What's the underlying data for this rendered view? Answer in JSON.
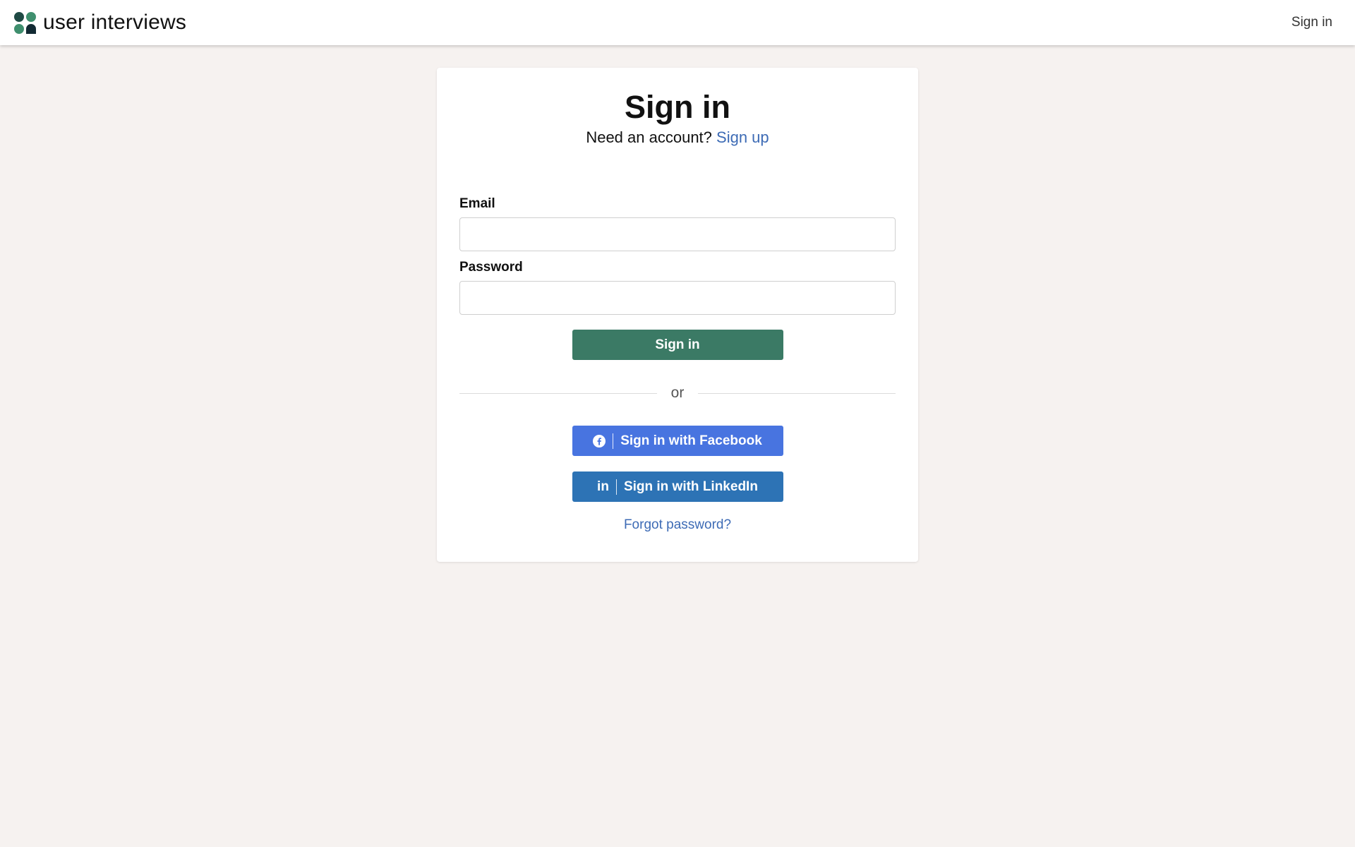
{
  "header": {
    "brand_name": "user interviews",
    "signin_link": "Sign in"
  },
  "form": {
    "title": "Sign in",
    "subtitle_text": "Need an account?",
    "signup_link": "Sign up",
    "email_label": "Email",
    "email_value": "",
    "password_label": "Password",
    "password_value": "",
    "submit_label": "Sign in",
    "divider_text": "or",
    "facebook_label": "Sign in with Facebook",
    "linkedin_label": "Sign in with LinkedIn",
    "linkedin_icon_text": "in",
    "forgot_link": "Forgot password?"
  },
  "icons": {
    "logo": "user-interviews-logo-icon",
    "facebook": "facebook-icon",
    "linkedin": "linkedin-icon"
  },
  "colors": {
    "background": "#f6f2f0",
    "primary_green": "#3b7a65",
    "facebook_blue": "#4874e0",
    "linkedin_blue": "#2d73b5",
    "link_blue": "#3d6bb5"
  }
}
